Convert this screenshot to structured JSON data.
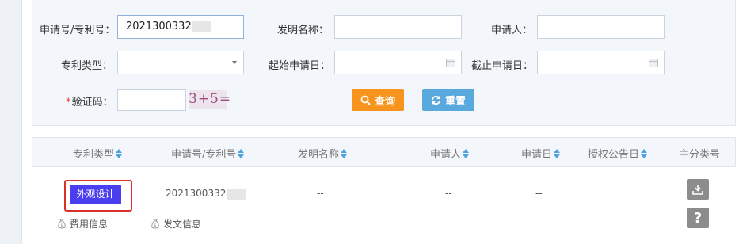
{
  "search": {
    "application_no_label": "申请号/专利号：",
    "application_no_value": "2021300332",
    "invention_name_label": "发明名称：",
    "applicant_label": "申请人：",
    "patent_type_label": "专利类型：",
    "start_date_label": "起始申请日：",
    "end_date_label": "截止申请日：",
    "captcha_label": "验证码：",
    "captcha_required_mark": "*",
    "captcha_text": "3+5=",
    "query_button": "查询",
    "reset_button": "重置"
  },
  "table": {
    "headers": [
      "专利类型",
      "申请号/专利号",
      "发明名称",
      "申请人",
      "申请日",
      "授权公告日",
      "主分类号"
    ],
    "rows": [
      {
        "patent_type": "外观设计",
        "application_no": "2021300332",
        "invention_name": "--",
        "applicant": "--",
        "application_date": "--",
        "fee_info": "费用信息",
        "doc_info": "发文信息",
        "help": "?"
      }
    ]
  },
  "colors": {
    "query_button": "#f7941d",
    "reset_button": "#5aa9de",
    "type_badge": "#4a3ff0",
    "highlight": "#d9302a",
    "sort_icon": "#4da3df"
  },
  "icons": {
    "query": "search-icon",
    "reset": "refresh-icon",
    "download": "download-icon",
    "help": "help-icon",
    "fee": "money-bag-icon"
  }
}
